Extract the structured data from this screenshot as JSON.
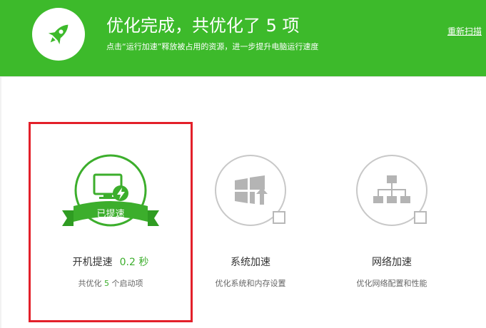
{
  "header": {
    "title": "优化完成，共优化了 5 项",
    "subtitle": "点击“运行加速”释放被占用的资源，进一步提升电脑运行速度",
    "rescan_label": "重新扫描"
  },
  "cards": [
    {
      "title": "开机提速",
      "time": "0.2 秒",
      "ribbon": "已提速",
      "desc_prefix": "共优化",
      "desc_count": "5",
      "desc_suffix": "个启动项",
      "icon": "monitor-lightning-icon",
      "status": "optimized"
    },
    {
      "title": "系统加速",
      "desc": "优化系统和内存设置",
      "icon": "windows-upload-icon"
    },
    {
      "title": "网络加速",
      "desc": "优化网络配置和性能",
      "icon": "network-tree-icon"
    }
  ],
  "colors": {
    "header_green": "#3dba2b",
    "accent_green": "#3cae2c",
    "highlight_red": "#e3202a",
    "icon_gray": "#b4b4b4"
  }
}
